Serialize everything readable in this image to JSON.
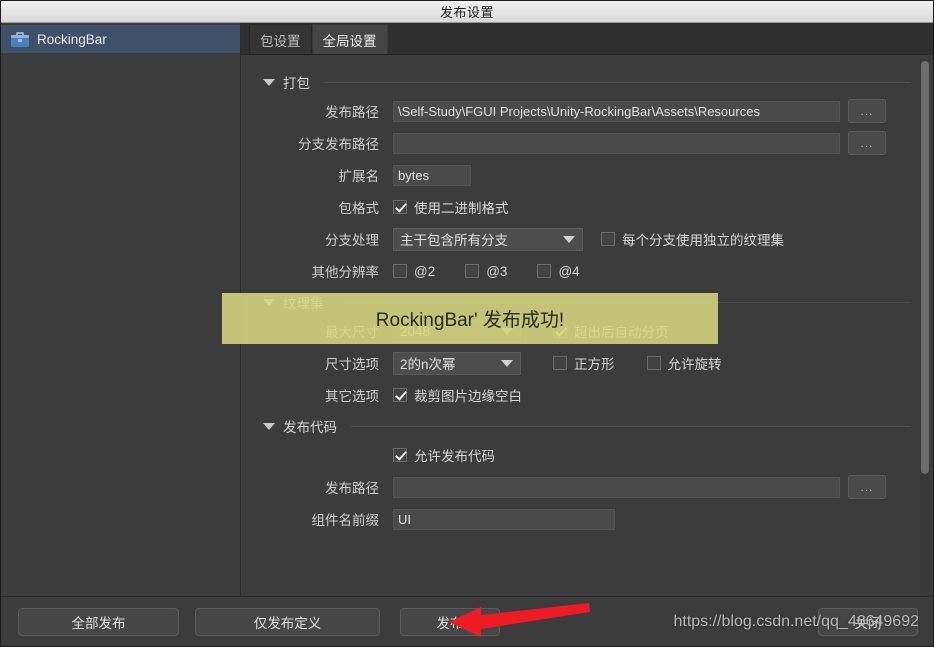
{
  "window": {
    "title": "发布设置"
  },
  "sidebar": {
    "items": [
      {
        "label": "RockingBar",
        "icon": "toolbox-icon",
        "selected": true
      }
    ]
  },
  "tabs": [
    {
      "label": "包设置",
      "active": false
    },
    {
      "label": "全局设置",
      "active": true
    }
  ],
  "sections": {
    "packing": {
      "title": "打包",
      "publish_path": {
        "label": "发布路径",
        "value": "\\Self-Study\\FGUI Projects\\Unity-RockingBar\\Assets\\Resources",
        "browse": "..."
      },
      "branch_path": {
        "label": "分支发布路径",
        "value": "",
        "browse": "..."
      },
      "extension": {
        "label": "扩展名",
        "value": "bytes"
      },
      "pack_format": {
        "label": "包格式",
        "checkbox_label": "使用二进制格式",
        "checked": true
      },
      "branch_mode": {
        "label": "分支处理",
        "value": "主干包含所有分支",
        "checkbox_label": "每个分支使用独立的纹理集",
        "checked": false
      },
      "other_res": {
        "label": "其他分辨率",
        "options": [
          {
            "label": "@2",
            "checked": false
          },
          {
            "label": "@3",
            "checked": false
          },
          {
            "label": "@4",
            "checked": false
          }
        ]
      }
    },
    "atlas": {
      "title": "纹理集",
      "max_size": {
        "label": "最大尺寸",
        "value": "2048",
        "checkbox_label": "超出后自动分页",
        "checked": true
      },
      "size_opt": {
        "label": "尺寸选项",
        "value": "2的n次幂",
        "square": {
          "label": "正方形",
          "checked": false
        },
        "rotate": {
          "label": "允许旋转",
          "checked": false
        }
      },
      "other_opt": {
        "label": "其它选项",
        "checkbox_label": "裁剪图片边缘空白",
        "checked": true
      }
    },
    "code": {
      "title": "发布代码",
      "allow": {
        "checkbox_label": "允许发布代码",
        "checked": true
      },
      "publish_path": {
        "label": "发布路径",
        "value": "",
        "browse": "..."
      },
      "prefix": {
        "label": "组件名前缀",
        "value": "UI"
      }
    }
  },
  "toast": {
    "message": "RockingBar' 发布成功!",
    "color": "#d7d680"
  },
  "footer": {
    "publish_all": "全部发布",
    "publish_def": "仅发布定义",
    "publish": "发布",
    "close": "关闭"
  },
  "watermark": {
    "text": "https://blog.csdn.net/qq_46649692"
  },
  "annotation": {
    "arrow_color": "#ed1c24",
    "points_to": "发布"
  }
}
